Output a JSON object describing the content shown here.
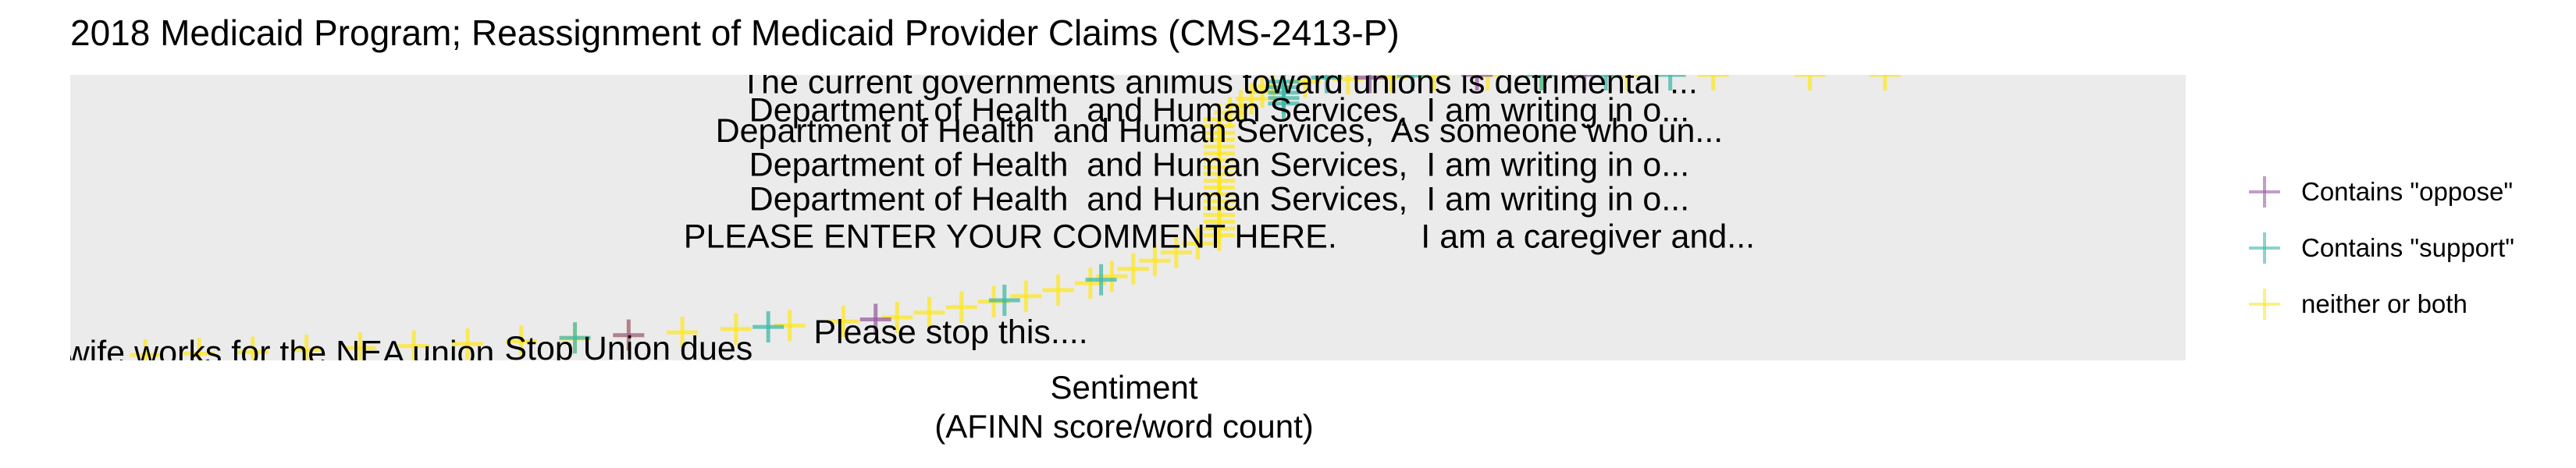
{
  "chart_data": {
    "type": "scatter",
    "title": "2018 Medicaid Program; Reassignment of Medicaid Provider Claims (CMS-2413-P)",
    "xlabel": "Sentiment\n(AFINN score/word count)",
    "ylabel": "",
    "grid": false,
    "legend_placement": "right",
    "legend": [
      {
        "label": "Contains \"oppose\"",
        "color": "#9a5ea1"
      },
      {
        "label": "Contains \"support\"",
        "color": "#3fb8a9"
      },
      {
        "label": "neither or both",
        "color": "#fde725"
      }
    ],
    "colors": {
      "oppose": "#9a5ea1",
      "support": "#3fb8a9",
      "neither": "#fde725",
      "panel": "#ebebeb"
    },
    "series": [
      {
        "name": "neither or both",
        "points": [
          {
            "x": -1.0,
            "y": 0.0
          },
          {
            "x": -0.95,
            "y": 0.2
          },
          {
            "x": -0.9,
            "y": 0.4
          },
          {
            "x": -0.85,
            "y": 0.7
          },
          {
            "x": -0.8,
            "y": 1.0
          },
          {
            "x": -0.75,
            "y": 1.3
          },
          {
            "x": -0.7,
            "y": 1.6
          },
          {
            "x": -0.65,
            "y": 2.0
          },
          {
            "x": -0.6,
            "y": 2.4
          },
          {
            "x": -0.55,
            "y": 2.8
          },
          {
            "x": -0.5,
            "y": 3.3
          },
          {
            "x": -0.45,
            "y": 3.8
          },
          {
            "x": -0.4,
            "y": 4.3
          },
          {
            "x": -0.35,
            "y": 4.9
          },
          {
            "x": -0.3,
            "y": 5.5
          },
          {
            "x": -0.27,
            "y": 6.2
          },
          {
            "x": -0.24,
            "y": 7.0
          },
          {
            "x": -0.21,
            "y": 7.8
          },
          {
            "x": -0.18,
            "y": 8.6
          },
          {
            "x": -0.15,
            "y": 9.5
          },
          {
            "x": -0.12,
            "y": 10.5
          },
          {
            "x": -0.1,
            "y": 11.5
          },
          {
            "x": -0.08,
            "y": 12.6
          },
          {
            "x": -0.06,
            "y": 13.8
          },
          {
            "x": -0.04,
            "y": 15.0
          },
          {
            "x": -0.02,
            "y": 16.3
          },
          {
            "x": 0.0,
            "y": 17.5
          },
          {
            "x": 0.0,
            "y": 18.5
          },
          {
            "x": 0.0,
            "y": 19.5
          },
          {
            "x": 0.0,
            "y": 20.5
          },
          {
            "x": 0.0,
            "y": 21.5
          },
          {
            "x": 0.0,
            "y": 22.5
          },
          {
            "x": 0.0,
            "y": 23.5
          },
          {
            "x": 0.0,
            "y": 24.5
          },
          {
            "x": 0.0,
            "y": 25.5
          },
          {
            "x": 0.0,
            "y": 26.5
          },
          {
            "x": 0.0,
            "y": 27.5
          },
          {
            "x": 0.0,
            "y": 28.5
          },
          {
            "x": 0.0,
            "y": 29.5
          },
          {
            "x": 0.0,
            "y": 30.5
          },
          {
            "x": 0.0,
            "y": 31.5
          },
          {
            "x": 0.0,
            "y": 32.5
          },
          {
            "x": 0.0,
            "y": 33.5
          },
          {
            "x": 0.0,
            "y": 34.5
          },
          {
            "x": 0.01,
            "y": 35.5
          },
          {
            "x": 0.02,
            "y": 36.5
          },
          {
            "x": 0.03,
            "y": 37.5
          },
          {
            "x": 0.04,
            "y": 38.5
          },
          {
            "x": 0.05,
            "y": 39.3
          },
          {
            "x": 0.08,
            "y": 40.0
          },
          {
            "x": 0.12,
            "y": 40.4
          },
          {
            "x": 0.16,
            "y": 40.7
          },
          {
            "x": 0.2,
            "y": 40.9
          },
          {
            "x": 0.25,
            "y": 41.0
          },
          {
            "x": 0.3,
            "y": 41.0
          },
          {
            "x": 0.38,
            "y": 41.0
          },
          {
            "x": 0.46,
            "y": 41.0
          },
          {
            "x": 0.55,
            "y": 41.0
          },
          {
            "x": 0.62,
            "y": 41.0
          }
        ]
      },
      {
        "name": "Contains \"support\"",
        "points": [
          {
            "x": -0.6,
            "y": 2.5
          },
          {
            "x": -0.42,
            "y": 4.1
          },
          {
            "x": -0.2,
            "y": 8.0
          },
          {
            "x": -0.11,
            "y": 11.0
          },
          {
            "x": 0.06,
            "y": 36.8
          },
          {
            "x": 0.06,
            "y": 37.6
          },
          {
            "x": 0.06,
            "y": 38.4
          },
          {
            "x": 0.06,
            "y": 39.2
          },
          {
            "x": 0.06,
            "y": 40.0
          },
          {
            "x": 0.1,
            "y": 40.6
          },
          {
            "x": 0.18,
            "y": 40.9
          },
          {
            "x": 0.3,
            "y": 41.0
          },
          {
            "x": 0.36,
            "y": 41.0
          },
          {
            "x": 0.42,
            "y": 41.0
          }
        ]
      },
      {
        "name": "Contains \"oppose\"",
        "points": [
          {
            "x": -0.55,
            "y": 2.9
          },
          {
            "x": -0.32,
            "y": 5.2
          },
          {
            "x": 0.14,
            "y": 40.6
          },
          {
            "x": 0.24,
            "y": 41.0
          },
          {
            "x": 0.34,
            "y": 41.0
          }
        ]
      }
    ],
    "annotations": [
      {
        "text": "The current governments animus toward unions is detrimental ...",
        "x": 0.0,
        "y": 39.6
      },
      {
        "text": "Department of Health  and Human Services,  I am writing in o...",
        "x": 0.0,
        "y": 35.5
      },
      {
        "text": "Department of Health  and Human Services,  As someone who un...",
        "x": 0.0,
        "y": 32.5
      },
      {
        "text": "Department of Health  and Human Services,  I am writing in o...",
        "x": 0.0,
        "y": 27.5
      },
      {
        "text": "Department of Health  and Human Services,  I am writing in o...",
        "x": 0.0,
        "y": 22.5
      },
      {
        "text": "PLEASE ENTER YOUR COMMENT HERE.         I am a caregiver and...",
        "x": 0.0,
        "y": 17.0
      },
      {
        "text": "Please stop this....",
        "x": -0.25,
        "y": 3.0
      },
      {
        "text": "Stop Union dues",
        "x": -0.55,
        "y": 0.6
      },
      {
        "text": "my wife works for the NEA union",
        "x": -0.9,
        "y": 0.0
      }
    ],
    "xlim": [
      -1.07,
      0.9
    ],
    "ylim": [
      -0.8,
      41.0
    ]
  }
}
